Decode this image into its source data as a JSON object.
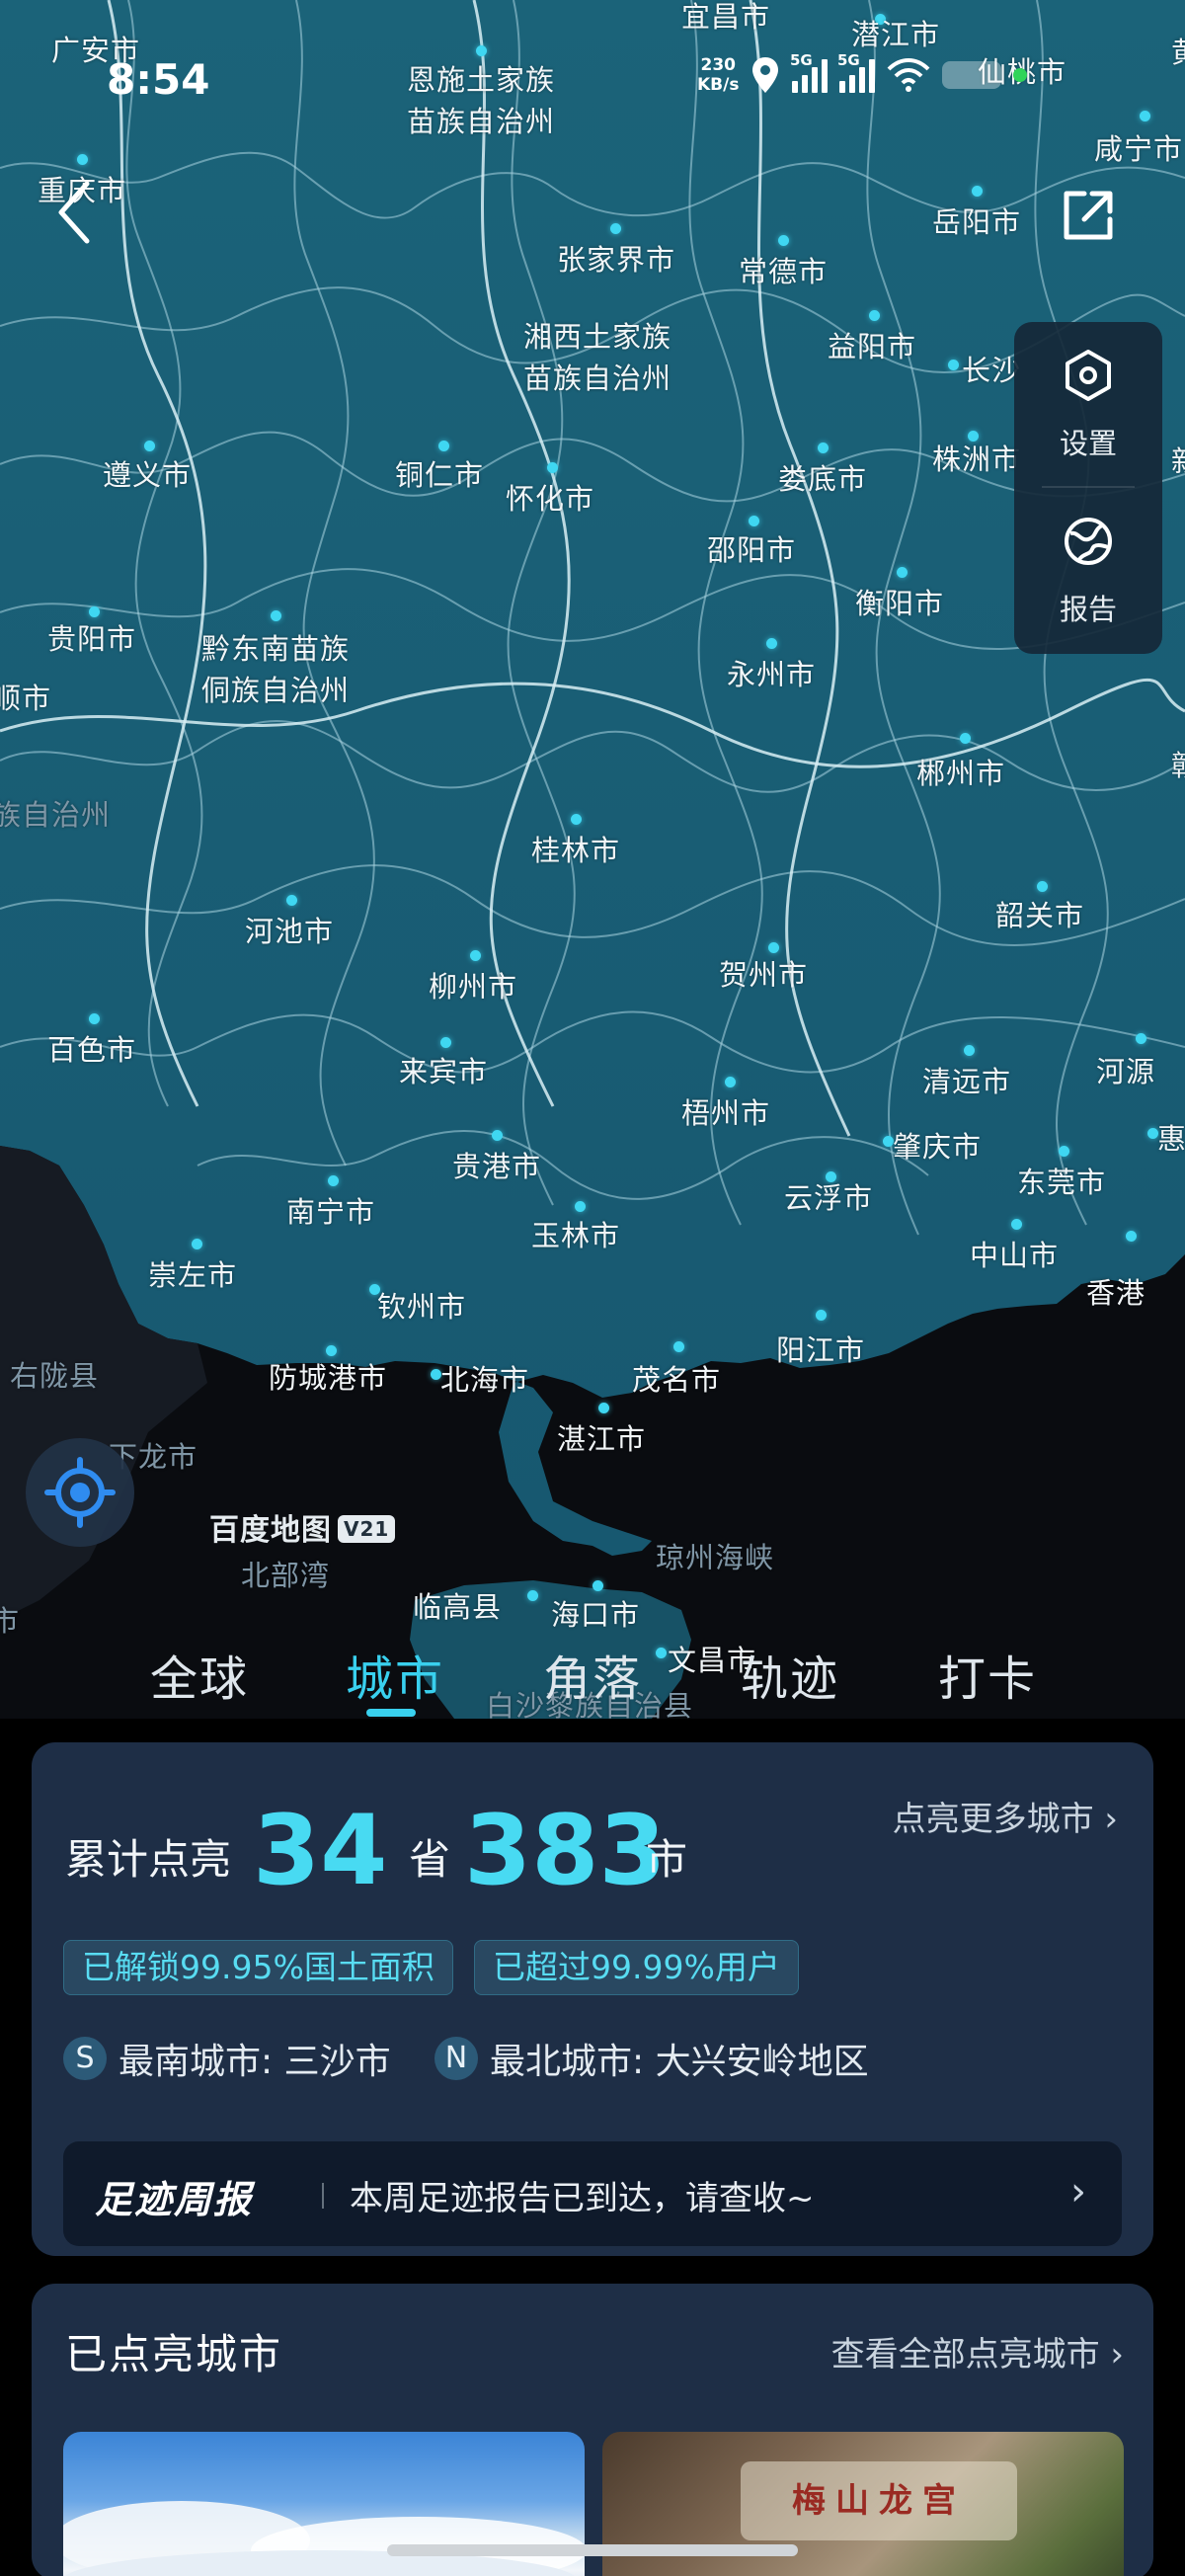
{
  "status_bar": {
    "time": "8:54",
    "net_speed": "230",
    "net_speed_unit": "KB/s",
    "signal1": "5G",
    "signal2": "5G"
  },
  "map": {
    "logo": "百度地图",
    "logo_version": "V21",
    "labels": [
      {
        "text": "广安市"
      },
      {
        "text": "宜昌市"
      },
      {
        "text": "潜江市"
      },
      {
        "text": "仙桃市"
      },
      {
        "text": "黄"
      },
      {
        "text": "恩施土家族"
      },
      {
        "text": "苗族自治州"
      },
      {
        "text": "咸宁市"
      },
      {
        "text": "重庆市"
      },
      {
        "text": "岳阳市"
      },
      {
        "text": "张家界市"
      },
      {
        "text": "常德市"
      },
      {
        "text": "湘西土家族"
      },
      {
        "text": "苗族自治州"
      },
      {
        "text": "益阳市"
      },
      {
        "text": "长沙"
      },
      {
        "text": "遵义市"
      },
      {
        "text": "铜仁市"
      },
      {
        "text": "怀化市"
      },
      {
        "text": "娄底市"
      },
      {
        "text": "株洲市"
      },
      {
        "text": "新"
      },
      {
        "text": "邵阳市"
      },
      {
        "text": "衡阳市"
      },
      {
        "text": "贵阳市"
      },
      {
        "text": "黔东南苗族"
      },
      {
        "text": "侗族自治州"
      },
      {
        "text": "顺市"
      },
      {
        "text": "永州市"
      },
      {
        "text": "郴州市"
      },
      {
        "text": "赣"
      },
      {
        "text": "族自治州"
      },
      {
        "text": "桂林市"
      },
      {
        "text": "河池市"
      },
      {
        "text": "韶关市"
      },
      {
        "text": "贺州市"
      },
      {
        "text": "柳州市"
      },
      {
        "text": "百色市"
      },
      {
        "text": "来宾市"
      },
      {
        "text": "清远市"
      },
      {
        "text": "河源"
      },
      {
        "text": "梧州市"
      },
      {
        "text": "肇庆市"
      },
      {
        "text": "惠"
      },
      {
        "text": "贵港市"
      },
      {
        "text": "东莞市"
      },
      {
        "text": "南宁市"
      },
      {
        "text": "云浮市"
      },
      {
        "text": "玉林市"
      },
      {
        "text": "中山市"
      },
      {
        "text": "崇左市"
      },
      {
        "text": "香港"
      },
      {
        "text": "钦州市"
      },
      {
        "text": "阳江市"
      },
      {
        "text": "右陇县"
      },
      {
        "text": "防城港市"
      },
      {
        "text": "北海市"
      },
      {
        "text": "茂名市"
      },
      {
        "text": "湛江市"
      },
      {
        "text": "下龙市"
      },
      {
        "text": "琼州海峡"
      },
      {
        "text": "北部湾"
      },
      {
        "text": "临高县"
      },
      {
        "text": "海口市"
      },
      {
        "text": "文昌市"
      },
      {
        "text": "白沙黎族自治县"
      },
      {
        "text": "市"
      }
    ]
  },
  "tools": {
    "settings_label": "设置",
    "report_label": "报告"
  },
  "tabs": [
    {
      "label": "全球"
    },
    {
      "label": "城市"
    },
    {
      "label": "角落"
    },
    {
      "label": "轨迹"
    },
    {
      "label": "打卡"
    }
  ],
  "summary": {
    "more_link": "点亮更多城市",
    "prefix": "累计点亮",
    "provinces": "34",
    "province_unit": "省",
    "cities": "383",
    "city_unit": "市",
    "pill_area": "已解锁99.95%国土面积",
    "pill_users": "已超过99.99%用户",
    "south_badge": "S",
    "south_text": "最南城市: 三沙市",
    "north_badge": "N",
    "north_text": "最北城市: 大兴安岭地区",
    "weekly_title": "足迹周报",
    "weekly_text": "本周足迹报告已到达，请查收~",
    "weekly_arrow": "›"
  },
  "lit_cities": {
    "title": "已点亮城市",
    "view_all": "查看全部点亮城市",
    "photo2_carving": "梅山龙宫"
  }
}
